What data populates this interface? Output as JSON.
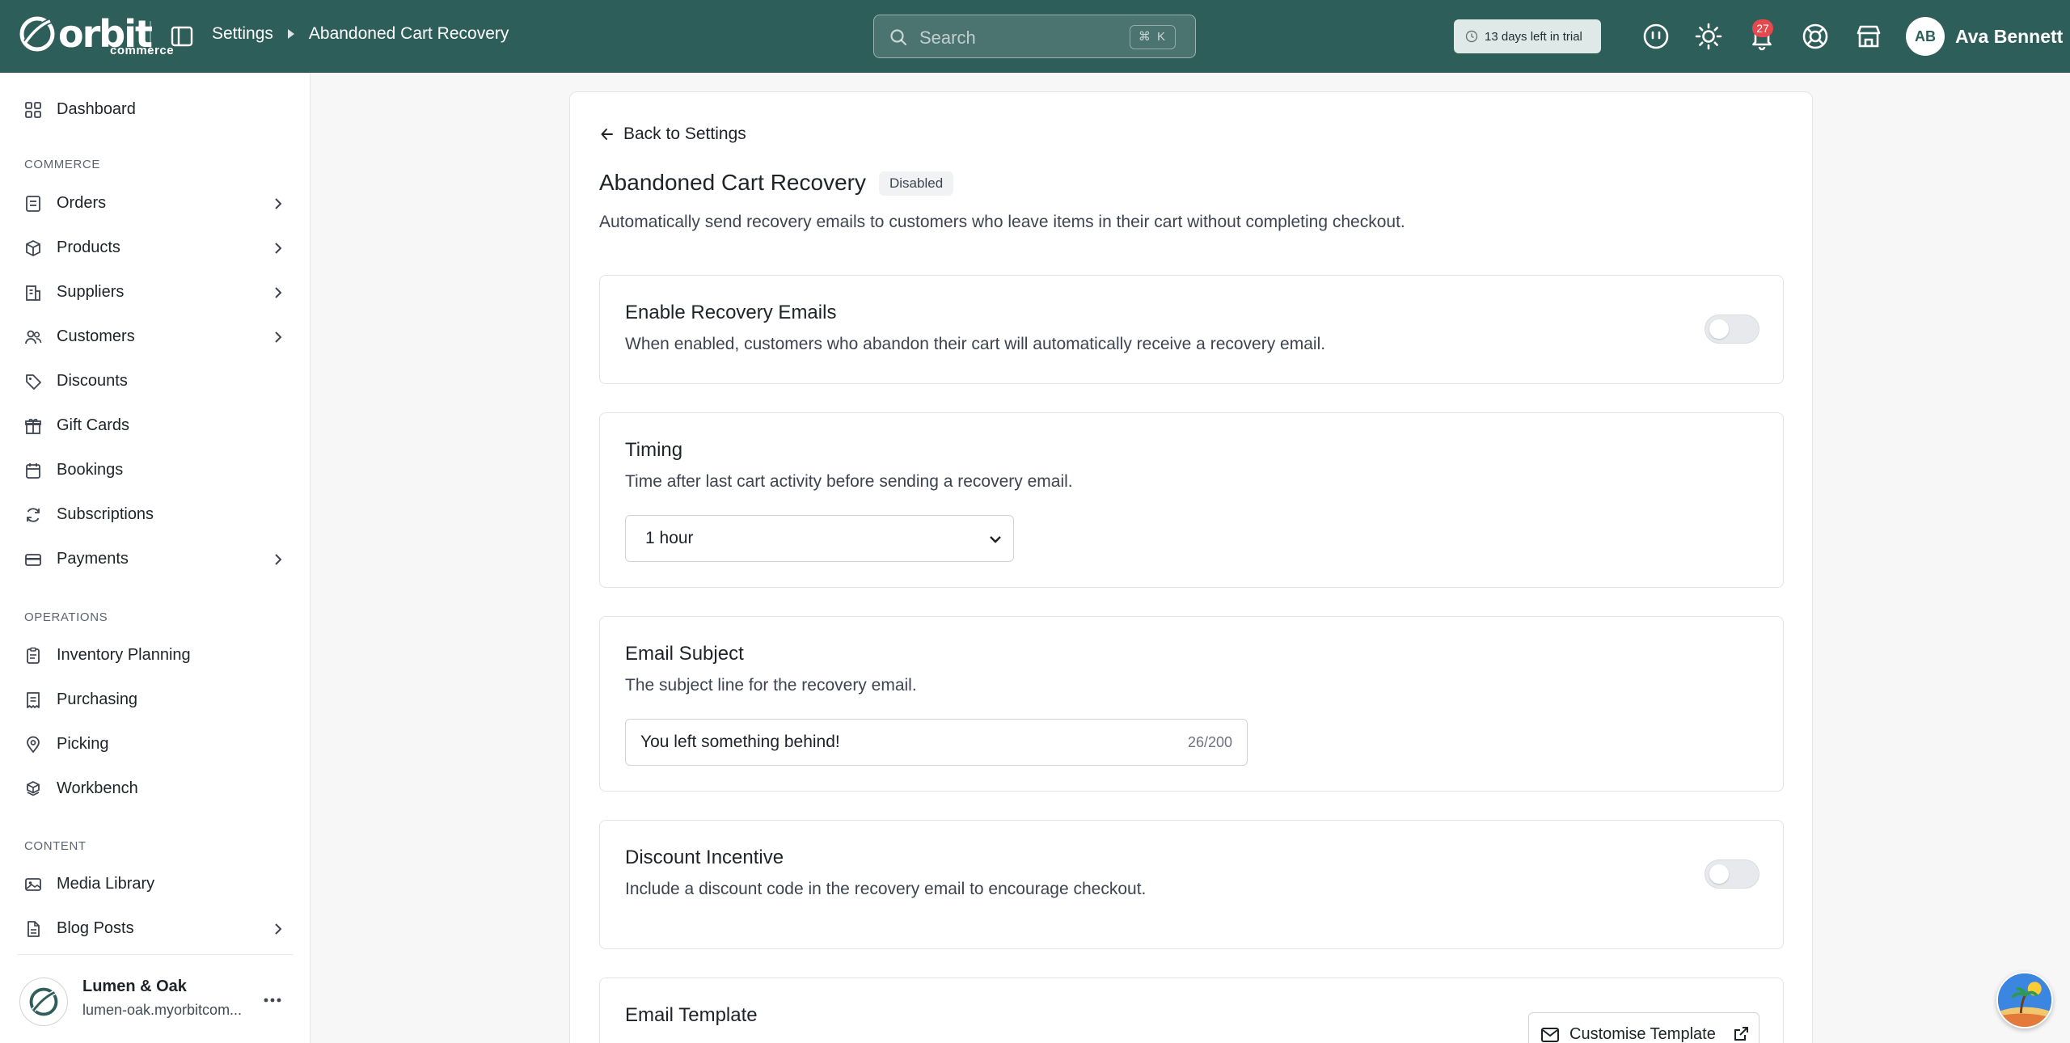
{
  "app": {
    "logo_text": "orbit",
    "logo_sub": "commerce"
  },
  "breadcrumb": {
    "parent": "Settings",
    "current": "Abandoned Cart Recovery"
  },
  "search": {
    "placeholder": "Search",
    "shortcut": "⌘ K"
  },
  "trial": {
    "label": "13 days left in trial"
  },
  "notifications": {
    "count": "27"
  },
  "user": {
    "initials": "AB",
    "name": "Ava Bennett"
  },
  "sidebar": {
    "dashboard": "Dashboard",
    "sections": {
      "commerce": "COMMERCE",
      "operations": "OPERATIONS",
      "content": "CONTENT"
    },
    "commerce_items": [
      {
        "label": "Orders",
        "icon": "orders-icon",
        "expandable": true
      },
      {
        "label": "Products",
        "icon": "box-icon",
        "expandable": true
      },
      {
        "label": "Suppliers",
        "icon": "building-icon",
        "expandable": true
      },
      {
        "label": "Customers",
        "icon": "users-icon",
        "expandable": true
      },
      {
        "label": "Discounts",
        "icon": "tag-icon",
        "expandable": false
      },
      {
        "label": "Gift Cards",
        "icon": "gift-icon",
        "expandable": false
      },
      {
        "label": "Bookings",
        "icon": "calendar-icon",
        "expandable": false
      },
      {
        "label": "Subscriptions",
        "icon": "refresh-icon",
        "expandable": false
      },
      {
        "label": "Payments",
        "icon": "card-icon",
        "expandable": true
      }
    ],
    "operations_items": [
      {
        "label": "Inventory Planning",
        "icon": "clipboard-icon"
      },
      {
        "label": "Purchasing",
        "icon": "receipt-icon"
      },
      {
        "label": "Picking",
        "icon": "map-pin-icon"
      },
      {
        "label": "Workbench",
        "icon": "boxes-icon"
      }
    ],
    "content_items": [
      {
        "label": "Media Library",
        "icon": "image-icon",
        "expandable": false
      },
      {
        "label": "Blog Posts",
        "icon": "document-icon",
        "expandable": true
      }
    ],
    "store": {
      "name": "Lumen & Oak",
      "url": "lumen-oak.myorbitcom..."
    }
  },
  "page": {
    "back_label": "Back to Settings",
    "title": "Abandoned Cart Recovery",
    "status": "Disabled",
    "description": "Automatically send recovery emails to customers who leave items in their cart without completing checkout."
  },
  "cards": {
    "enable": {
      "title": "Enable Recovery Emails",
      "description": "When enabled, customers who abandon their cart will automatically receive a recovery email.",
      "enabled": false
    },
    "timing": {
      "title": "Timing",
      "description": "Time after last cart activity before sending a recovery email.",
      "selected": "1 hour"
    },
    "subject": {
      "title": "Email Subject",
      "description": "The subject line for the recovery email.",
      "value": "You left something behind!",
      "counter": "26/200"
    },
    "discount": {
      "title": "Discount Incentive",
      "description": "Include a discount code in the recovery email to encourage checkout.",
      "enabled": false
    },
    "template": {
      "title": "Email Template",
      "button_label": "Customise Template"
    }
  },
  "colors": {
    "topbar": "#2e5e5a",
    "badge": "#e5484d"
  }
}
